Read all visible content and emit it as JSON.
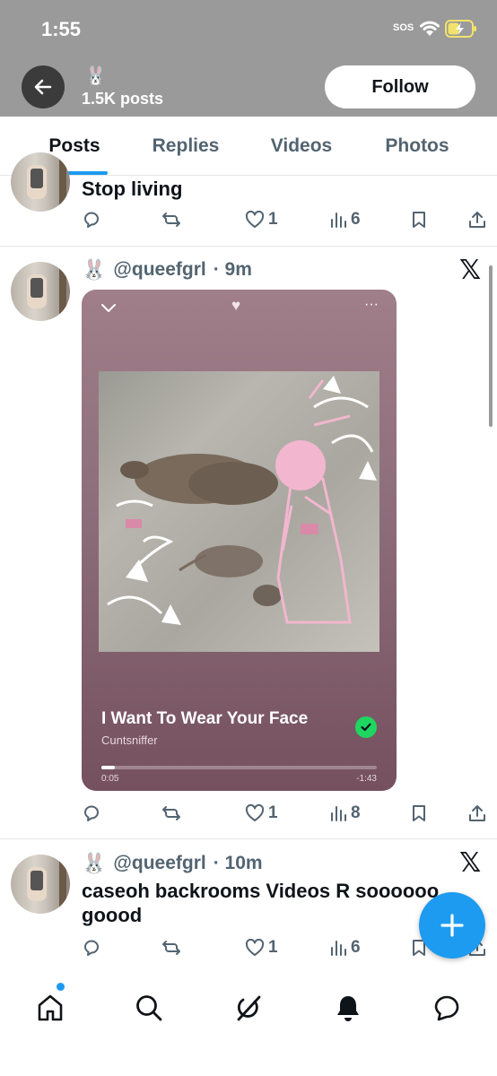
{
  "status_bar": {
    "time": "1:55",
    "sos": "SOS",
    "icons": [
      "wifi-icon",
      "battery-charging-icon"
    ]
  },
  "header": {
    "avatar_emoji": "🐰",
    "posts_count": "1.5K posts",
    "follow_label": "Follow",
    "back_icon": "arrow-left-icon"
  },
  "tabs": [
    {
      "label": "Posts",
      "active": true
    },
    {
      "label": "Replies",
      "active": false
    },
    {
      "label": "Videos",
      "active": false
    },
    {
      "label": "Photos",
      "active": false
    }
  ],
  "posts": [
    {
      "text": "Stop living",
      "actions": {
        "reply": "",
        "repost": "",
        "likes": "1",
        "views": "6"
      }
    },
    {
      "emoji": "🐰",
      "handle": "@queefgrl",
      "time": "· 9m",
      "badge": "𝕏",
      "card": {
        "song_title": "I Want To Wear Your Face",
        "artist": "Cuntsniffer",
        "elapsed": "0:05",
        "remaining": "-1:43",
        "progress": 0.05,
        "heart": "♥",
        "menu": "···"
      },
      "actions": {
        "reply": "",
        "repost": "",
        "likes": "1",
        "views": "8"
      }
    },
    {
      "emoji": "🐰",
      "handle": "@queefgrl",
      "time": "· 10m",
      "badge": "𝕏",
      "text": "caseoh backrooms Videos R soooooo goood",
      "actions": {
        "reply": "",
        "repost": "",
        "likes": "1",
        "views": "6"
      }
    }
  ],
  "bottom_nav": [
    "home-icon",
    "search-icon",
    "grok-icon",
    "notifications-icon",
    "messages-icon"
  ],
  "colors": {
    "accent": "#1d9bf0",
    "header_bg": "#9a9a9a",
    "check": "#1ed760"
  }
}
